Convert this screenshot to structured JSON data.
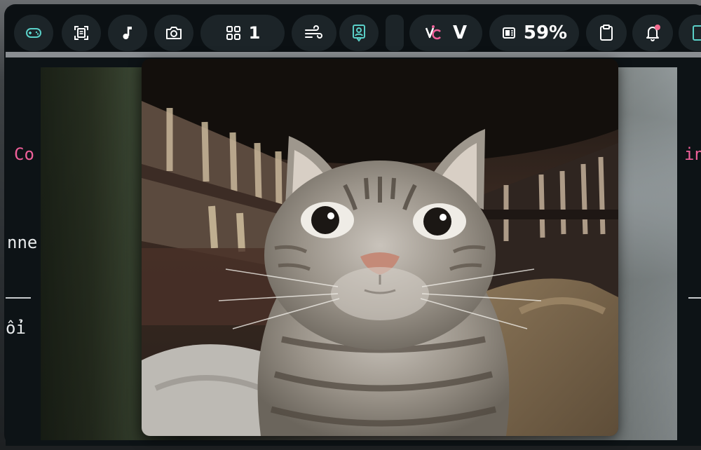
{
  "statusbar": {
    "workspace_count": "1",
    "vc_label": "V",
    "battery_percent": "59%",
    "notification_dot_color": "#f36b8f"
  },
  "background": {
    "left_texts": [
      "Co",
      "nne",
      "ổi"
    ],
    "right_texts": [
      "in"
    ]
  },
  "icons": {
    "gamepad": "gamepad-icon",
    "screenshot": "screenshot-frame-icon",
    "music": "music-note-icon",
    "camera": "camera-icon",
    "workspaces": "grid-icon",
    "wind": "wind-icon",
    "contact": "contact-card-icon",
    "vc": "vc-logo-icon",
    "battery": "battery-chip-icon",
    "clipboard": "clipboard-icon",
    "bell": "bell-icon",
    "edge": "phone-icon"
  },
  "colors": {
    "accent": "#5ad0c8",
    "pink": "#f0609a",
    "bar_bg": "#0b1013",
    "pill_bg": "#1c2428"
  },
  "popup": {
    "image": "cat-photo"
  }
}
